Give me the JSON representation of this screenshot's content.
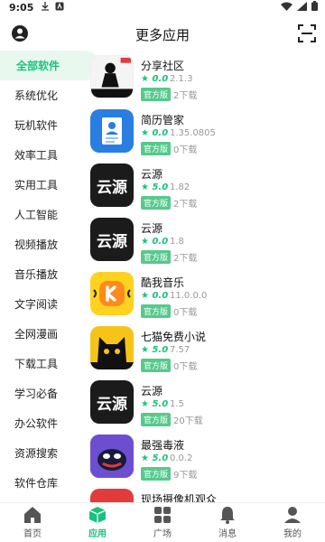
{
  "status": {
    "time": "9:05"
  },
  "header": {
    "title": "更多应用",
    "user_icon": "user-circle-icon",
    "scan_icon": "scan-icon"
  },
  "sidebar": {
    "items": [
      {
        "label": "全部软件",
        "active": true
      },
      {
        "label": "系统优化"
      },
      {
        "label": "玩机软件"
      },
      {
        "label": "效率工具"
      },
      {
        "label": "实用工具"
      },
      {
        "label": "人工智能"
      },
      {
        "label": "视频播放"
      },
      {
        "label": "音乐播放"
      },
      {
        "label": "文字阅读"
      },
      {
        "label": "全网漫画"
      },
      {
        "label": "下载工具"
      },
      {
        "label": "学习必备"
      },
      {
        "label": "办公软件"
      },
      {
        "label": "资源搜索"
      },
      {
        "label": "软件仓库"
      }
    ]
  },
  "apps": [
    {
      "name": "分享社区",
      "rating": "★ 0.0",
      "version": "2.1.3",
      "badge": "官方版",
      "downloads": "2下载",
      "icon": "share-community-icon"
    },
    {
      "name": "简历管家",
      "rating": "★ 0.0",
      "version": "1.35.0805",
      "badge": "官方版",
      "downloads": "0下载",
      "icon": "resume-icon"
    },
    {
      "name": "云源",
      "rating": "★ 5.0",
      "version": "1.82",
      "badge": "官方版",
      "downloads": "2下载",
      "icon": "yunyuan-icon",
      "icon_text": "云源"
    },
    {
      "name": "云源",
      "rating": "★ 0.0",
      "version": "1.8",
      "badge": "官方版",
      "downloads": "2下载",
      "icon": "yunyuan-icon",
      "icon_text": "云源"
    },
    {
      "name": "酷我音乐",
      "rating": "★ 0.0",
      "version": "11.0.0.0",
      "badge": "官方版",
      "downloads": "0下载",
      "icon": "kuwo-music-icon"
    },
    {
      "name": "七猫免费小说",
      "rating": "★ 5.0",
      "version": "7.57",
      "badge": "官方版",
      "downloads": "0下载",
      "icon": "qimao-cat-icon"
    },
    {
      "name": "云源",
      "rating": "★ 5.0",
      "version": "1.5",
      "badge": "官方版",
      "downloads": "20下载",
      "icon": "yunyuan-icon",
      "icon_text": "云源"
    },
    {
      "name": "最强毒液",
      "rating": "★ 5.0",
      "version": "0.0.2",
      "badge": "官方版",
      "downloads": "9下载",
      "icon": "venom-icon"
    },
    {
      "name": "现场摄像机观众",
      "rating": "",
      "version": "",
      "badge": "",
      "downloads": "",
      "icon": "camera-icon"
    }
  ],
  "bottom_nav": [
    {
      "label": "首页",
      "icon": "home-icon"
    },
    {
      "label": "应用",
      "icon": "cube-icon",
      "active": true
    },
    {
      "label": "广场",
      "icon": "grid-icon"
    },
    {
      "label": "消息",
      "icon": "bell-icon"
    },
    {
      "label": "我的",
      "icon": "person-icon"
    }
  ],
  "colors": {
    "accent": "#19c37d",
    "badge": "#56c98c",
    "sidebar_active_bg": "#e9f8ef"
  }
}
